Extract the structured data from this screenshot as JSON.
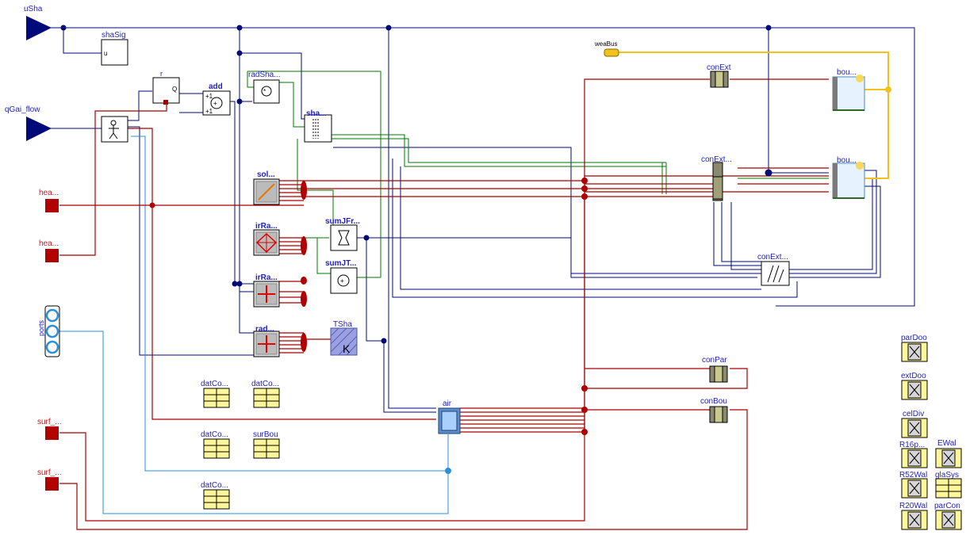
{
  "inputs": {
    "uSha": "uSha",
    "qGai_flow": "qGai_flow"
  },
  "blocks": {
    "shaSig": "shaSig",
    "shaSig_port": "u",
    "r": "r",
    "r_port": "Q",
    "add": "add",
    "radSha": "radSha...",
    "sha": "sha...",
    "sol": "sol...",
    "irRa1": "irRa...",
    "irRa2": "irRa...",
    "rad": "rad...",
    "sumJFr": "sumJFr...",
    "sumJT": "sumJT...",
    "TSha": "TSha",
    "TSha_unit": "K",
    "air": "air",
    "weaBus": "weaBus",
    "conExt": "conExt",
    "bou1": "bou...",
    "conExt2": "conExt...",
    "bou2": "bou...",
    "conExt3": "conExt...",
    "conPar": "conPar",
    "conBou": "conBou",
    "ports": "ports"
  },
  "heat_ports": [
    "hea...",
    "hea...",
    "surf_...",
    "surf_..."
  ],
  "data_records": [
    "datCo...",
    "datCo...",
    "datCo...",
    "surBou",
    "datCo..."
  ],
  "materials": [
    {
      "label": "parDoo"
    },
    {
      "label": "extDoo"
    },
    {
      "label": "celDiv"
    },
    {
      "label": "R16p..."
    },
    {
      "label": "EWal"
    },
    {
      "label": "R52Wal"
    },
    {
      "label": "glaSys"
    },
    {
      "label": "R20Wal"
    },
    {
      "label": "parCon"
    }
  ],
  "colors": {
    "heat": "#a80000",
    "signal": "#000a78",
    "radiation": "#007a00",
    "fluid": "#2b8fdc",
    "weather": "#f2c11c",
    "label": "#1f1fbf"
  }
}
